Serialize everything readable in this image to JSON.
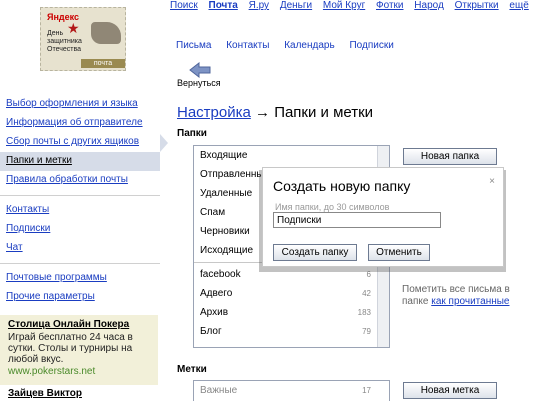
{
  "topnav": {
    "links": [
      "Поиск",
      "Почта",
      "Я.ру",
      "Деньги",
      "Мой Круг",
      "Фотки",
      "Народ",
      "Открытки",
      "ещё"
    ]
  },
  "logo": {
    "brand": "Яндекс",
    "caption": "День защитника Отечества",
    "mail_label": "почта"
  },
  "tabs": [
    "Письма",
    "Контакты",
    "Календарь",
    "Подписки"
  ],
  "back_label": "Вернуться",
  "sidebar": {
    "group1": [
      "Выбор оформления и языка",
      "Информация об отправителе",
      "Сбор почты с других ящиков",
      "Папки и метки",
      "Правила обработки почты"
    ],
    "group2": [
      "Контакты",
      "Подписки",
      "Чат"
    ],
    "group3": [
      "Почтовые программы",
      "Прочие параметры"
    ],
    "active_index": 3
  },
  "ad": {
    "title": "Столица Онлайн Покера",
    "body": "Играй бесплатно 24 часа в сутки. Столы и турниры на любой вкус.",
    "url": "www.pokerstars.net",
    "title2": "Зайцев Виктор"
  },
  "main": {
    "breadcrumb_link": "Настройка",
    "breadcrumb_arrow": "→",
    "page_title": "Папки и метки",
    "folders_heading": "Папки",
    "labels_heading": "Метки",
    "new_folder_btn": "Новая папка",
    "new_label_btn": "Новая метка",
    "mark_all_text": "Пометить все письма в",
    "mark_all_text2": "папке",
    "mark_all_link": "как прочитанные"
  },
  "folders": {
    "system": [
      "Входящие",
      "Отправленные",
      "Удаленные",
      "Спам",
      "Черновики",
      "Исходящие"
    ],
    "user": [
      {
        "name": "facebook",
        "count": "6"
      },
      {
        "name": "Адвего",
        "count": "42"
      },
      {
        "name": "Архив",
        "count": "183"
      },
      {
        "name": "Блог",
        "count": "79"
      }
    ]
  },
  "labels": [
    {
      "name": "Важные",
      "count": "17"
    }
  ],
  "dialog": {
    "title": "Создать новую папку",
    "close": "×",
    "hint": "Имя папки, до 30 символов",
    "value": "Подписки",
    "create_btn": "Создать папку",
    "cancel_btn": "Отменить"
  }
}
